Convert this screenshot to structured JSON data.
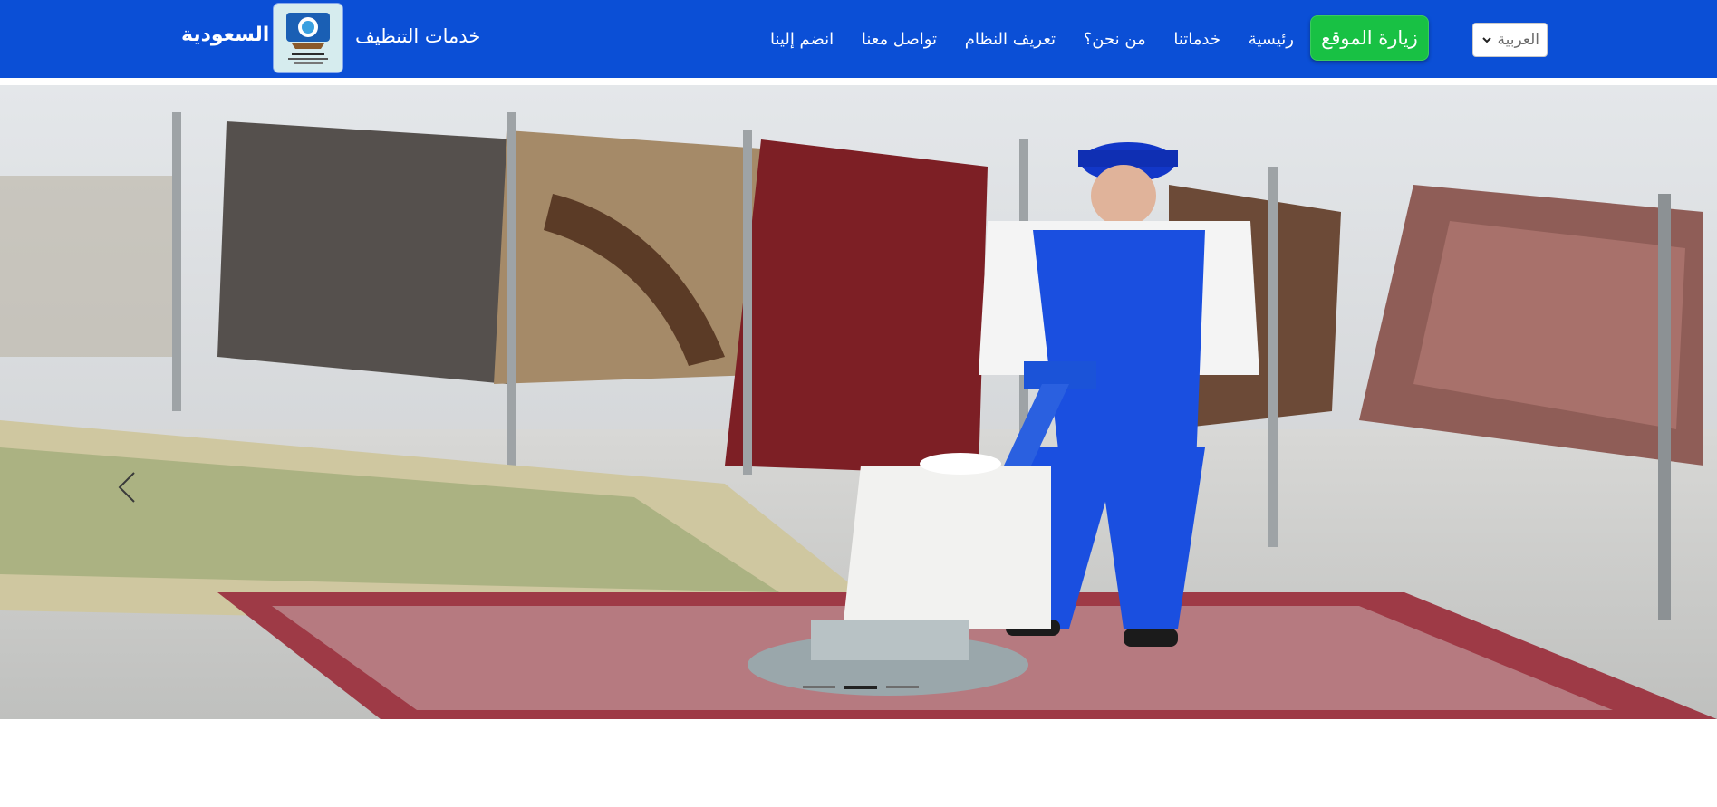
{
  "header": {
    "country": "السعودية",
    "brand_name": "خدمات التنظيف",
    "nav_links": [
      {
        "id": "home",
        "label": "رئيسية"
      },
      {
        "id": "services",
        "label": "خدماتنا"
      },
      {
        "id": "about",
        "label": "من نحن؟"
      },
      {
        "id": "system",
        "label": "تعريف النظام"
      },
      {
        "id": "contact",
        "label": "تواصل معنا"
      },
      {
        "id": "join",
        "label": "انضم إلينا"
      }
    ],
    "visit_button": "زيارة الموقع",
    "language": {
      "selected": "العربية"
    }
  },
  "carousel": {
    "slide_count": 3,
    "active_index": 1
  },
  "colors": {
    "navbar": "#0b4fd6",
    "visit_button": "#18c144",
    "text_on_nav": "#ffffff"
  }
}
